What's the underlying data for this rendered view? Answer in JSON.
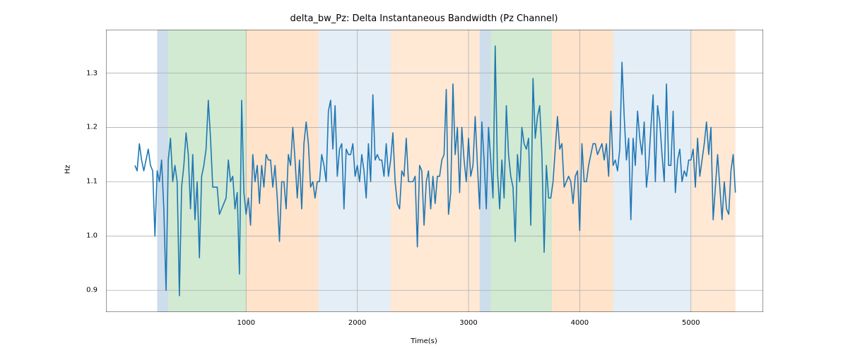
{
  "chart_data": {
    "type": "line",
    "title": "delta_bw_Pz: Delta Instantaneous Bandwidth (Pz Channel)",
    "xlabel": "Time(s)",
    "ylabel": "Hz",
    "xlim": [
      -260,
      5650
    ],
    "ylim": [
      0.86,
      1.38
    ],
    "xticks": [
      1000,
      2000,
      3000,
      4000,
      5000
    ],
    "yticks": [
      0.9,
      1.0,
      1.1,
      1.2,
      1.3
    ],
    "regions": [
      {
        "start": 200,
        "end": 300,
        "color": "#6f9fc6",
        "alpha": 0.35
      },
      {
        "start": 300,
        "end": 1000,
        "color": "#2ca02c",
        "alpha": 0.22
      },
      {
        "start": 1000,
        "end": 1650,
        "color": "#ff7f0e",
        "alpha": 0.22
      },
      {
        "start": 1650,
        "end": 2300,
        "color": "#1f77b4",
        "alpha": 0.12
      },
      {
        "start": 2300,
        "end": 3100,
        "color": "#ff7f0e",
        "alpha": 0.18
      },
      {
        "start": 3100,
        "end": 3200,
        "color": "#6f9fc6",
        "alpha": 0.35
      },
      {
        "start": 3200,
        "end": 3750,
        "color": "#2ca02c",
        "alpha": 0.22
      },
      {
        "start": 3750,
        "end": 4300,
        "color": "#ff7f0e",
        "alpha": 0.22
      },
      {
        "start": 4300,
        "end": 5000,
        "color": "#1f77b4",
        "alpha": 0.12
      },
      {
        "start": 5000,
        "end": 5400,
        "color": "#ff7f0e",
        "alpha": 0.18
      }
    ],
    "line_color": "#1f77b4",
    "x": [
      0,
      20,
      40,
      60,
      80,
      100,
      120,
      140,
      160,
      180,
      200,
      220,
      240,
      260,
      280,
      300,
      320,
      340,
      360,
      380,
      400,
      420,
      440,
      460,
      480,
      500,
      520,
      540,
      560,
      580,
      600,
      620,
      640,
      660,
      680,
      700,
      720,
      740,
      760,
      780,
      800,
      820,
      840,
      860,
      880,
      900,
      920,
      940,
      960,
      980,
      1000,
      1020,
      1040,
      1060,
      1080,
      1100,
      1120,
      1140,
      1160,
      1180,
      1200,
      1220,
      1240,
      1260,
      1280,
      1300,
      1320,
      1340,
      1360,
      1380,
      1400,
      1420,
      1440,
      1460,
      1480,
      1500,
      1520,
      1540,
      1560,
      1580,
      1600,
      1620,
      1640,
      1660,
      1680,
      1700,
      1720,
      1740,
      1760,
      1780,
      1800,
      1820,
      1840,
      1860,
      1880,
      1900,
      1920,
      1940,
      1960,
      1980,
      2000,
      2020,
      2040,
      2060,
      2080,
      2100,
      2120,
      2140,
      2160,
      2180,
      2200,
      2220,
      2240,
      2260,
      2280,
      2300,
      2320,
      2340,
      2360,
      2380,
      2400,
      2420,
      2440,
      2460,
      2480,
      2500,
      2520,
      2540,
      2560,
      2580,
      2600,
      2620,
      2640,
      2660,
      2680,
      2700,
      2720,
      2740,
      2760,
      2780,
      2800,
      2820,
      2840,
      2860,
      2880,
      2900,
      2920,
      2940,
      2960,
      2980,
      3000,
      3020,
      3040,
      3060,
      3080,
      3100,
      3120,
      3140,
      3160,
      3180,
      3200,
      3220,
      3240,
      3260,
      3280,
      3300,
      3320,
      3340,
      3360,
      3380,
      3400,
      3420,
      3440,
      3460,
      3480,
      3500,
      3520,
      3540,
      3560,
      3580,
      3600,
      3620,
      3640,
      3660,
      3680,
      3700,
      3720,
      3740,
      3760,
      3780,
      3800,
      3820,
      3840,
      3860,
      3880,
      3900,
      3920,
      3940,
      3960,
      3980,
      4000,
      4020,
      4040,
      4060,
      4080,
      4100,
      4120,
      4140,
      4160,
      4180,
      4200,
      4220,
      4240,
      4260,
      4280,
      4300,
      4320,
      4340,
      4360,
      4380,
      4400,
      4420,
      4440,
      4460,
      4480,
      4500,
      4520,
      4540,
      4560,
      4580,
      4600,
      4620,
      4640,
      4660,
      4680,
      4700,
      4720,
      4740,
      4760,
      4780,
      4800,
      4820,
      4840,
      4860,
      4880,
      4900,
      4920,
      4940,
      4960,
      4980,
      5000,
      5020,
      5040,
      5060,
      5080,
      5100,
      5120,
      5140,
      5160,
      5180,
      5200,
      5220,
      5240,
      5260,
      5280,
      5300,
      5320,
      5340,
      5360,
      5380,
      5400
    ],
    "y": [
      1.13,
      1.12,
      1.17,
      1.14,
      1.12,
      1.14,
      1.16,
      1.13,
      1.12,
      1.0,
      1.12,
      1.1,
      1.14,
      1.05,
      0.9,
      1.14,
      1.18,
      1.1,
      1.13,
      1.1,
      0.89,
      1.09,
      1.13,
      1.19,
      1.15,
      1.05,
      1.15,
      1.03,
      1.1,
      0.96,
      1.11,
      1.13,
      1.16,
      1.25,
      1.18,
      1.09,
      1.09,
      1.09,
      1.04,
      1.05,
      1.06,
      1.07,
      1.14,
      1.1,
      1.11,
      1.05,
      1.08,
      0.93,
      1.25,
      1.08,
      1.04,
      1.07,
      1.02,
      1.15,
      1.1,
      1.13,
      1.06,
      1.13,
      1.09,
      1.15,
      1.14,
      1.14,
      1.09,
      1.13,
      1.07,
      0.99,
      1.1,
      1.1,
      1.05,
      1.15,
      1.13,
      1.2,
      1.14,
      1.07,
      1.14,
      1.05,
      1.17,
      1.21,
      1.17,
      1.09,
      1.1,
      1.07,
      1.1,
      1.1,
      1.15,
      1.13,
      1.1,
      1.23,
      1.25,
      1.16,
      1.24,
      1.11,
      1.16,
      1.17,
      1.05,
      1.16,
      1.15,
      1.15,
      1.17,
      1.11,
      1.13,
      1.1,
      1.15,
      1.12,
      1.07,
      1.17,
      1.1,
      1.26,
      1.14,
      1.15,
      1.14,
      1.14,
      1.11,
      1.17,
      1.11,
      1.14,
      1.19,
      1.1,
      1.06,
      1.05,
      1.12,
      1.11,
      1.18,
      1.1,
      1.1,
      1.1,
      1.11,
      0.98,
      1.13,
      1.12,
      1.02,
      1.1,
      1.12,
      1.05,
      1.11,
      1.06,
      1.11,
      1.11,
      1.14,
      1.15,
      1.27,
      1.04,
      1.08,
      1.28,
      1.15,
      1.2,
      1.08,
      1.2,
      1.14,
      1.1,
      1.18,
      1.11,
      1.13,
      1.22,
      1.13,
      1.05,
      1.21,
      1.14,
      1.05,
      1.2,
      1.14,
      1.07,
      1.35,
      1.12,
      1.05,
      1.14,
      1.07,
      1.24,
      1.15,
      1.11,
      1.09,
      0.99,
      1.15,
      1.1,
      1.2,
      1.17,
      1.16,
      1.18,
      1.02,
      1.29,
      1.18,
      1.22,
      1.24,
      1.15,
      0.97,
      1.13,
      1.07,
      1.07,
      1.1,
      1.16,
      1.22,
      1.16,
      1.17,
      1.09,
      1.1,
      1.11,
      1.1,
      1.06,
      1.11,
      1.12,
      1.01,
      1.17,
      1.1,
      1.1,
      1.13,
      1.15,
      1.17,
      1.17,
      1.15,
      1.16,
      1.17,
      1.14,
      1.17,
      1.11,
      1.23,
      1.13,
      1.14,
      1.12,
      1.16,
      1.32,
      1.22,
      1.14,
      1.18,
      1.03,
      1.18,
      1.13,
      1.23,
      1.18,
      1.15,
      1.21,
      1.09,
      1.13,
      1.2,
      1.26,
      1.1,
      1.24,
      1.21,
      1.15,
      1.1,
      1.28,
      1.13,
      1.13,
      1.23,
      1.08,
      1.14,
      1.16,
      1.1,
      1.12,
      1.11,
      1.14,
      1.14,
      1.16,
      1.09,
      1.18,
      1.11,
      1.14,
      1.17,
      1.21,
      1.15,
      1.2,
      1.03,
      1.09,
      1.15,
      1.09,
      1.03,
      1.1,
      1.05,
      1.04,
      1.12,
      1.15,
      1.08
    ]
  }
}
